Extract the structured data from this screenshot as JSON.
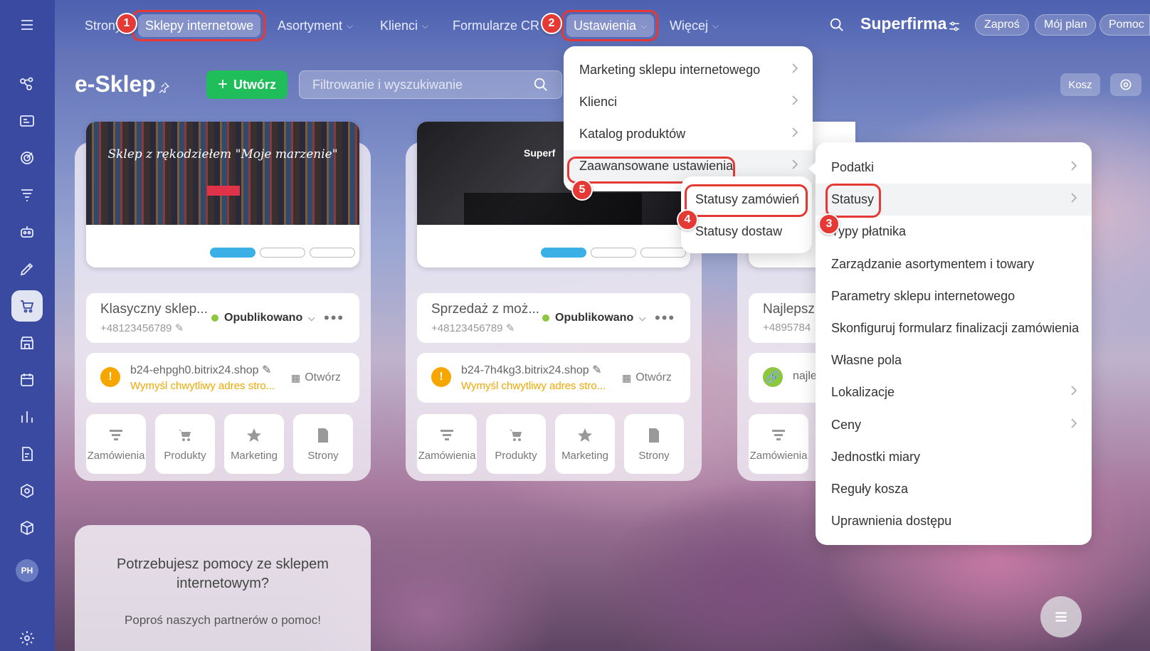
{
  "nav": {
    "items": [
      "Strony",
      "Sklepy internetowe",
      "Asortyment",
      "Klienci",
      "Formularze CRM",
      "Ustawienia",
      "Więcej"
    ],
    "brand": "Superfirma",
    "invite": "Zaproś",
    "plan": "Mój plan",
    "help": "Pomoc"
  },
  "page": {
    "title": "e-Sklep",
    "create": "Utwórz",
    "search_placeholder": "Filtrowanie i wyszukiwanie",
    "trash": "Kosz"
  },
  "sidebar": {
    "avatar": "PH"
  },
  "cards": [
    {
      "thumb_title": "Sklep z rękodziełem \"Moje marzenie\"",
      "name": "Klasyczny sklep...",
      "phone": "+48123456789",
      "status": "Opublikowano",
      "domain": "b24-ehpgh0.bitrix24.shop",
      "warning": "Wymyśl chwytliwy adres stro...",
      "open": "Otwórz"
    },
    {
      "thumb_title": "Superf",
      "name": "Sprzedaż z moż...",
      "phone": "+48123456789",
      "status": "Opublikowano",
      "domain": "b24-7h4kg3.bitrix24.shop",
      "warning": "Wymyśl chwytliwy adres stro...",
      "open": "Otwórz"
    },
    {
      "name": "Najlepsz",
      "phone": "+4895784",
      "domain": "najle"
    }
  ],
  "tiles": [
    "Zamówienia",
    "Produkty",
    "Marketing",
    "Strony"
  ],
  "help_card": {
    "title": "Potrzebujesz pomocy ze sklepem internetowym?",
    "subtitle": "Poproś naszych partnerów o pomoc!"
  },
  "settings_menu": [
    "Marketing sklepu internetowego",
    "Klienci",
    "Katalog produktów",
    "Zaawansowane ustawienia"
  ],
  "status_submenu": [
    "Statusy zamówień",
    "Statusy dostaw"
  ],
  "advanced_menu": [
    "Podatki",
    "Statusy",
    "Typy płatnika",
    "Zarządzanie asortymentem i towary",
    "Parametry sklepu internetowego",
    "Skonfiguruj formularz finalizacji zamówienia",
    "Własne pola",
    "Lokalizacje",
    "Ceny",
    "Jednostki miary",
    "Reguły kosza",
    "Uprawnienia dostępu"
  ],
  "badges": [
    "1",
    "2",
    "3",
    "4",
    "5"
  ],
  "colors": {
    "accent_red": "#e53935",
    "create_green": "#1fbe5a",
    "status_green": "#8dc63f",
    "warning": "#f0a800",
    "sidebar": "#3a4aa0"
  }
}
